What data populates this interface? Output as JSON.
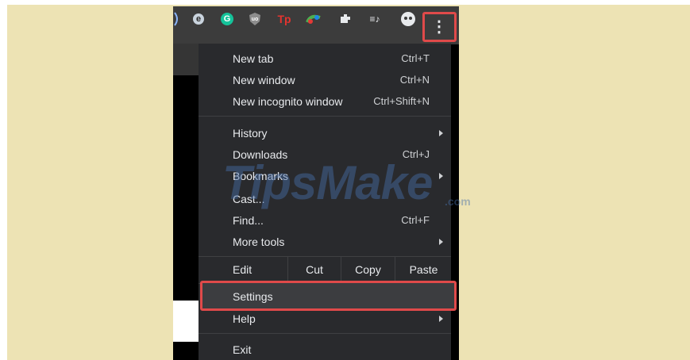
{
  "toolbar": {
    "icons": [
      "tab-edge-icon",
      "extension-e-icon",
      "grammarly-icon",
      "ublock-icon",
      "tp-extension-icon",
      "color-extension-icon",
      "puzzle-extensions-icon",
      "playlist-icon",
      "profile-avatar-icon",
      "kebab-menu-icon"
    ],
    "icon_glyphs": {
      "e": "e",
      "g": "G",
      "ub": "uo",
      "tp": "Tp",
      "playlist": "≡♪",
      "kebab": "⋮"
    },
    "colors": {
      "grammarly": "#15c39a",
      "tp": "#e3342f",
      "highlight": "#e04a4a"
    }
  },
  "menu": {
    "new_tab": {
      "label": "New tab",
      "shortcut": "Ctrl+T"
    },
    "new_window": {
      "label": "New window",
      "shortcut": "Ctrl+N"
    },
    "new_incognito": {
      "label": "New incognito window",
      "shortcut": "Ctrl+Shift+N"
    },
    "history": {
      "label": "History"
    },
    "downloads": {
      "label": "Downloads",
      "shortcut": "Ctrl+J"
    },
    "bookmarks": {
      "label": "Bookmarks"
    },
    "cast": {
      "label": "Cast..."
    },
    "find": {
      "label": "Find...",
      "shortcut": "Ctrl+F"
    },
    "more_tools": {
      "label": "More tools"
    },
    "edit": {
      "label": "Edit",
      "cut": "Cut",
      "copy": "Copy",
      "paste": "Paste"
    },
    "settings": {
      "label": "Settings"
    },
    "help": {
      "label": "Help"
    },
    "exit": {
      "label": "Exit"
    }
  },
  "watermark": {
    "text": "TipsMake",
    "suffix": ".com"
  }
}
